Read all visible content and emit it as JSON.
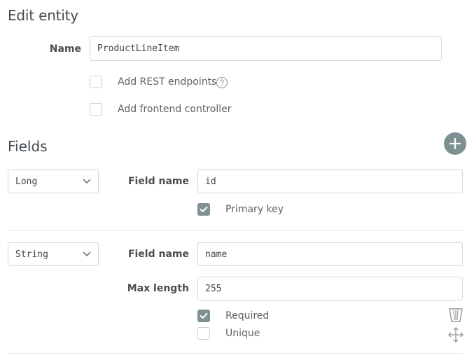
{
  "entity": {
    "title": "Edit entity",
    "name_label": "Name",
    "name_value": "ProductLineItem",
    "options": [
      {
        "label": "Add REST endpoints",
        "checked": false
      },
      {
        "label": "Add frontend controller",
        "checked": false
      }
    ]
  },
  "fields_section": {
    "title": "Fields",
    "add_icon": "plus-icon"
  },
  "fields": [
    {
      "type": "Long",
      "field_name_label": "Field name",
      "field_name_value": "id",
      "checks": [
        {
          "label": "Primary key",
          "checked": true
        }
      ]
    },
    {
      "type": "String",
      "field_name_label": "Field name",
      "field_name_value": "name",
      "max_length_label": "Max length",
      "max_length_value": "255",
      "checks": [
        {
          "label": "Required",
          "checked": true
        },
        {
          "label": "Unique",
          "checked": false
        }
      ]
    }
  ],
  "colors": {
    "accent": "#7e9192",
    "border": "#d3d7da",
    "text": "#4a4f53"
  },
  "icons": {
    "help": "question-circle-icon",
    "dropdown": "chevron-down-icon",
    "delete": "trash-icon",
    "move": "move-arrows-icon",
    "check": "checkmark-icon"
  }
}
